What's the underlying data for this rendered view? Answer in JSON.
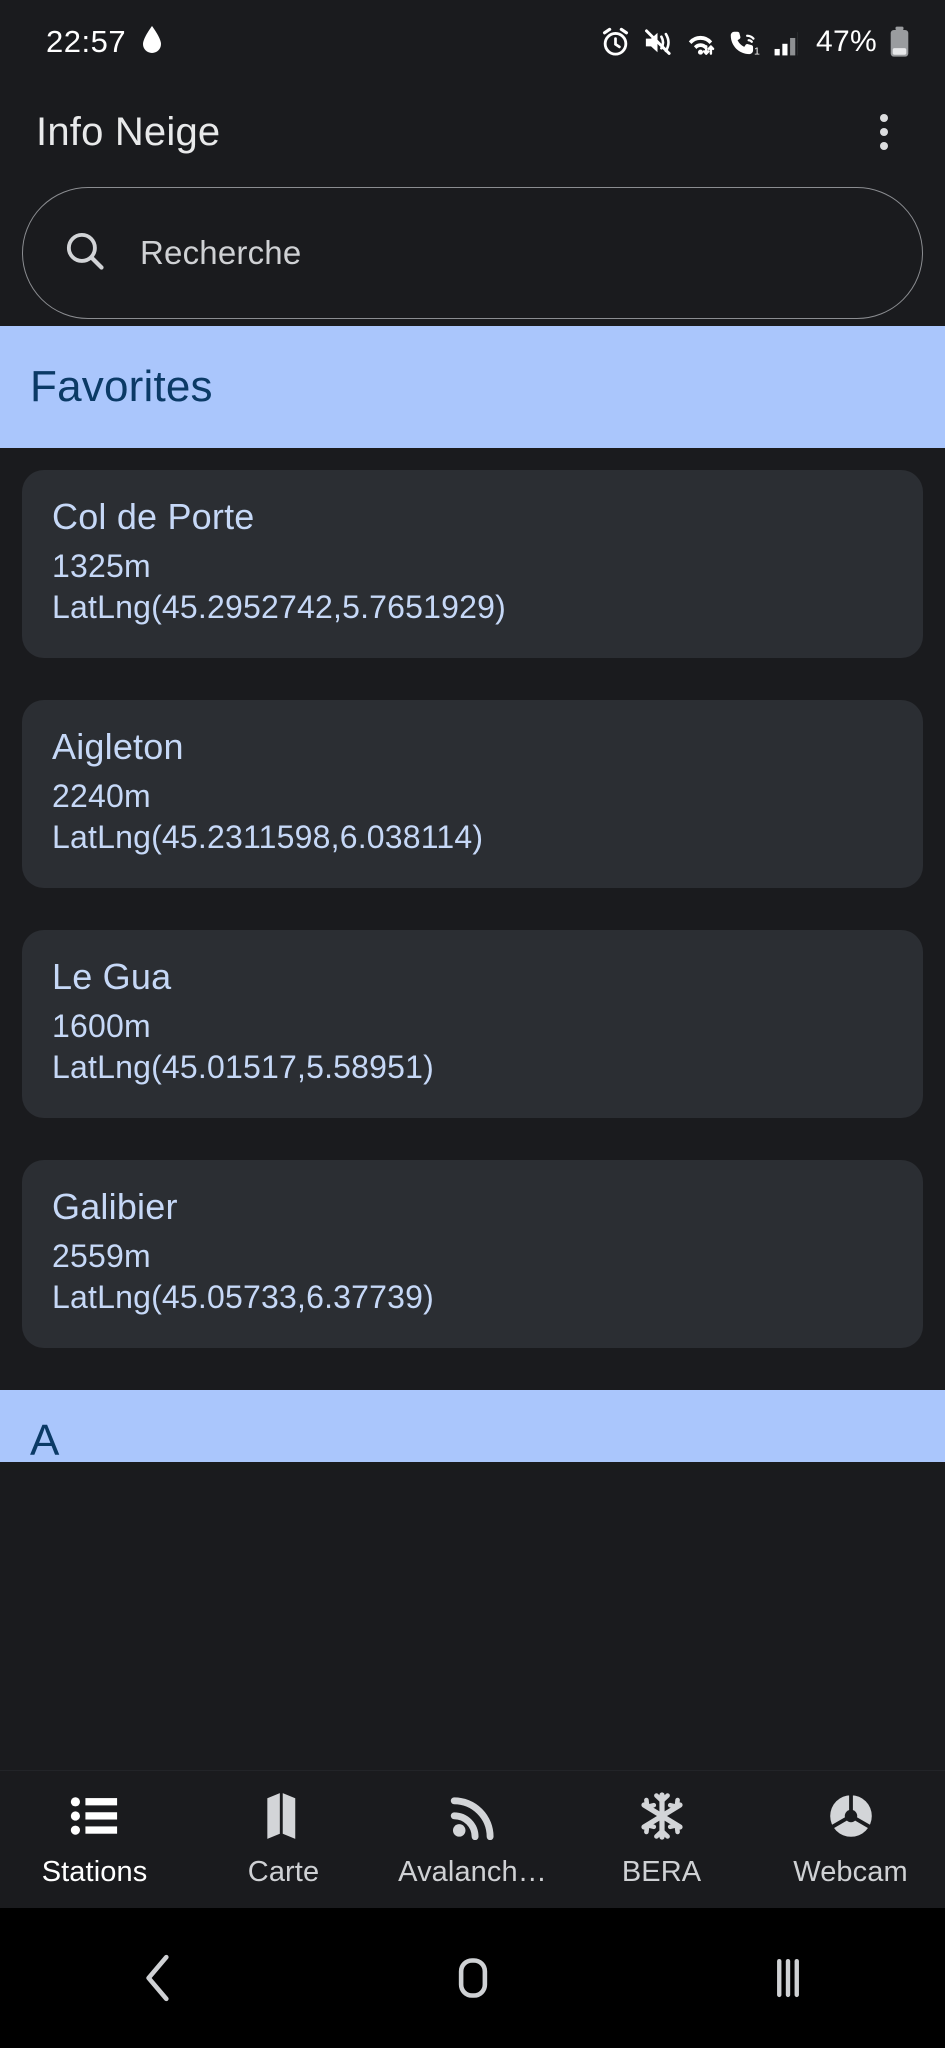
{
  "status_bar": {
    "time": "22:57",
    "battery_percent": "47%",
    "icons": [
      "water-drop-icon",
      "alarm-icon",
      "mute-vibrate-icon",
      "wifi-icon",
      "wifi-calling-icon",
      "cellular-signal-icon",
      "battery-icon"
    ]
  },
  "app_bar": {
    "title": "Info Neige",
    "overflow_label": "more-options"
  },
  "search": {
    "placeholder": "Recherche",
    "value": "",
    "icon": "search-icon"
  },
  "sections": [
    {
      "label": "Favorites"
    },
    {
      "label": "A"
    }
  ],
  "stations": [
    {
      "name": "Col de Porte",
      "altitude": "1325m",
      "latlng": "LatLng(45.2952742,5.7651929)"
    },
    {
      "name": "Aigleton",
      "altitude": "2240m",
      "latlng": "LatLng(45.2311598,6.038114)"
    },
    {
      "name": "Le Gua",
      "altitude": "1600m",
      "latlng": "LatLng(45.01517,5.58951)"
    },
    {
      "name": "Galibier",
      "altitude": "2559m",
      "latlng": "LatLng(45.05733,6.37739)"
    }
  ],
  "bottom_nav": {
    "items": [
      {
        "label": "Stations",
        "icon": "list-icon",
        "active": true
      },
      {
        "label": "Carte",
        "icon": "map-icon",
        "active": false
      },
      {
        "label": "Avalanch…",
        "icon": "rss-icon",
        "active": false
      },
      {
        "label": "BERA",
        "icon": "snowflake-icon",
        "active": false
      },
      {
        "label": "Webcam",
        "icon": "camera-aperture-icon",
        "active": false
      }
    ]
  },
  "android_nav": {
    "items": [
      {
        "name": "back-icon"
      },
      {
        "name": "home-icon"
      },
      {
        "name": "recents-icon"
      }
    ]
  },
  "colors": {
    "background": "#1a1b1e",
    "card": "#2b2e33",
    "section_banner": "#aac6fc",
    "section_text": "#0b3a66",
    "card_text": "#c6d8f7"
  }
}
